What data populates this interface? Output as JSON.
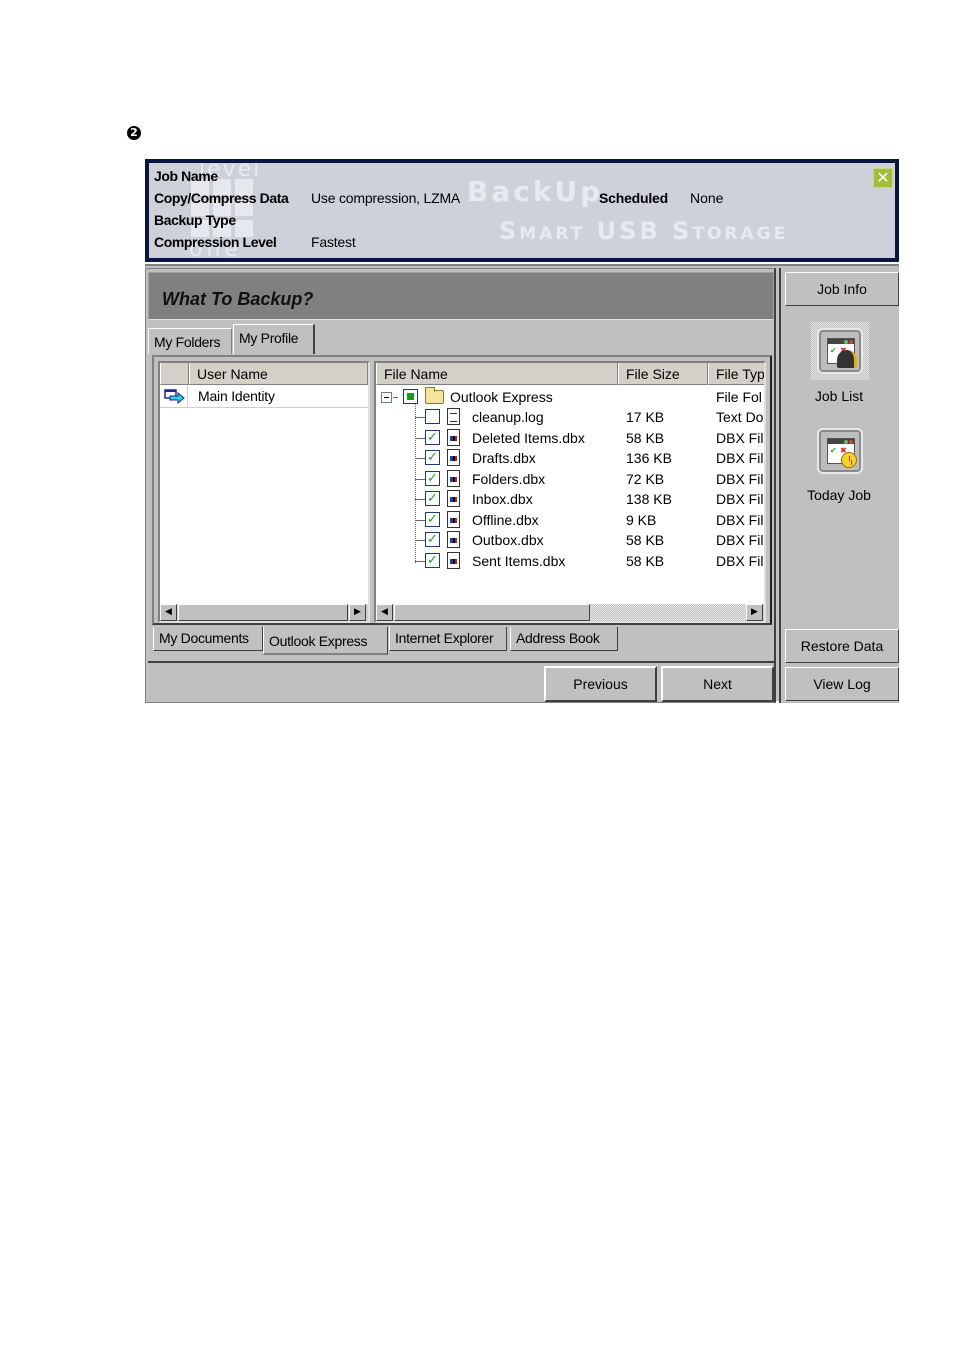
{
  "step_marker": "❷",
  "info_panel": {
    "watermark_brand_top": "level",
    "watermark_brand_bottom": "one",
    "watermark_product": "BackUp",
    "watermark_tagline": "Smart USB Storage",
    "rows": [
      {
        "label": "Job Name",
        "value": ""
      },
      {
        "label": "Copy/Compress Data",
        "value": "Use compression, LZMA"
      },
      {
        "label": "Backup Type",
        "value": ""
      },
      {
        "label": "Compression Level",
        "value": "Fastest"
      }
    ],
    "scheduled": {
      "label": "Scheduled",
      "value": "None"
    },
    "close_glyph": "✕",
    "close_color": "#9fbf3c",
    "background_color": "#0b1640"
  },
  "main": {
    "title": "What To Backup?",
    "top_tabs": [
      {
        "label": "My Folders",
        "active": false
      },
      {
        "label": "My Profile",
        "active": true
      }
    ],
    "user_table": {
      "columns": [
        "",
        "User Name"
      ],
      "rows": [
        {
          "icon": "identity-arrow-icon",
          "name": "Main Identity"
        }
      ]
    },
    "file_table": {
      "columns": [
        "File Name",
        "File Size",
        "File Typ"
      ],
      "root": {
        "name": "Outlook Express",
        "size": "",
        "type": "File Fol",
        "state": "partial",
        "expanded": true
      },
      "children": [
        {
          "name": "cleanup.log",
          "size": "17 KB",
          "type": "Text Do",
          "checked": false,
          "icon": "text-file-icon"
        },
        {
          "name": "Deleted Items.dbx",
          "size": "58 KB",
          "type": "DBX Fil",
          "checked": true,
          "icon": "dbx-file-icon"
        },
        {
          "name": "Drafts.dbx",
          "size": "136 KB",
          "type": "DBX Fil",
          "checked": true,
          "icon": "dbx-file-icon"
        },
        {
          "name": "Folders.dbx",
          "size": "72 KB",
          "type": "DBX Fil",
          "checked": true,
          "icon": "dbx-file-icon"
        },
        {
          "name": "Inbox.dbx",
          "size": "138 KB",
          "type": "DBX Fil",
          "checked": true,
          "icon": "dbx-file-icon"
        },
        {
          "name": "Offline.dbx",
          "size": "9 KB",
          "type": "DBX Fil",
          "checked": true,
          "icon": "dbx-file-icon"
        },
        {
          "name": "Outbox.dbx",
          "size": "58 KB",
          "type": "DBX Fil",
          "checked": true,
          "icon": "dbx-file-icon"
        },
        {
          "name": "Sent Items.dbx",
          "size": "58 KB",
          "type": "DBX Fil",
          "checked": true,
          "icon": "dbx-file-icon"
        }
      ]
    },
    "scroll_left_glyph": "◀",
    "scroll_right_glyph": "▶",
    "bottom_tabs": [
      {
        "label": "My Documents",
        "active": false
      },
      {
        "label": "Outlook Express",
        "active": true
      },
      {
        "label": "Internet Explorer",
        "active": false
      },
      {
        "label": "Address Book",
        "active": false
      }
    ],
    "buttons": {
      "previous": "Previous",
      "next": "Next"
    }
  },
  "sidebar": {
    "job_info": "Job Info",
    "job_list": "Job List",
    "today_job": "Today Job",
    "restore_data": "Restore Data",
    "view_log": "View Log",
    "check_glyph": "✔",
    "x_glyph": "✖"
  }
}
